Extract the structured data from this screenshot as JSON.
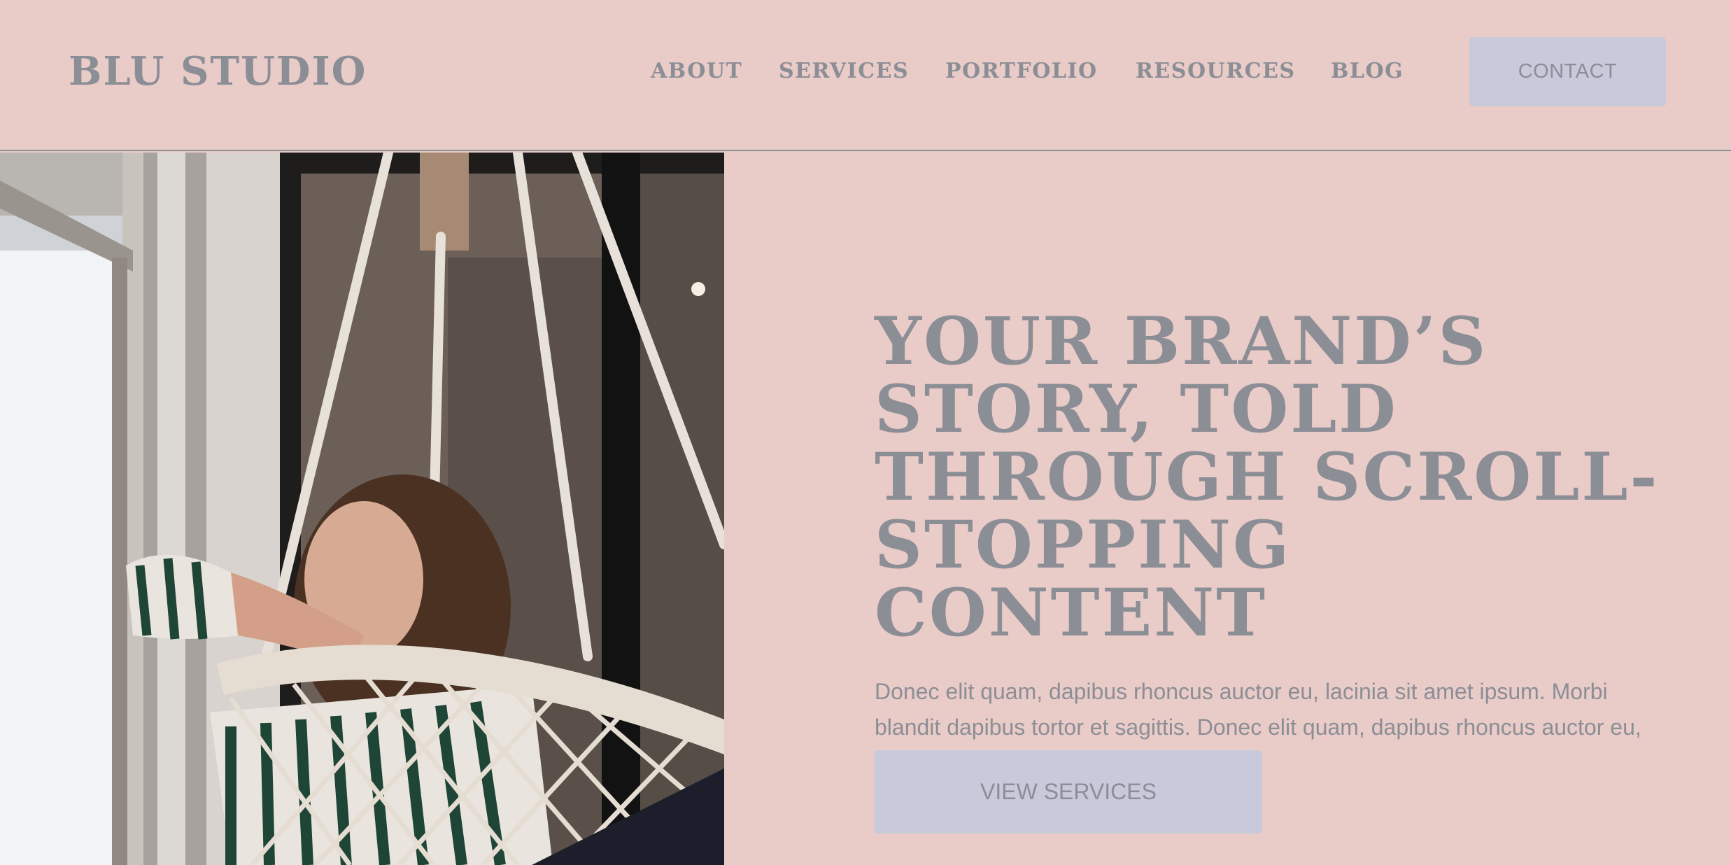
{
  "header": {
    "logo": "BLU STUDIO",
    "nav": [
      "ABOUT",
      "SERVICES",
      "PORTFOLIO",
      "RESOURCES",
      "BLOG"
    ],
    "contact_label": "CONTACT"
  },
  "hero": {
    "image_alt": "Woman in striped pajamas sitting in a white macrame hanging chair by a window",
    "headline": "YOUR BRAND’S STORY, TOLD THROUGH SCROLL-STOPPING CONTENT",
    "body": "Donec elit quam, dapibus rhoncus auctor eu, lacinia sit amet ipsum. Morbi blandit dapibus tortor et sagittis. Donec elit quam, dapibus rhoncus auctor eu, lacinia sit amet ipsum.",
    "cta_label": "VIEW SERVICES"
  },
  "colors": {
    "background": "#e9cbc8",
    "text": "#8c8e96",
    "button": "#c9c9dc"
  }
}
